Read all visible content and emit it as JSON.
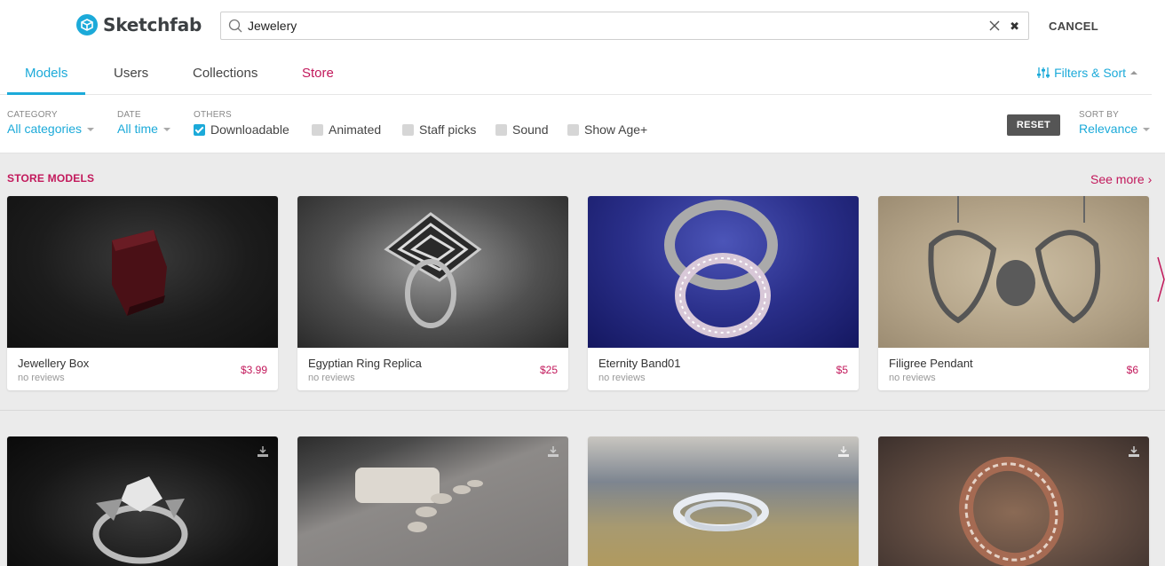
{
  "app": {
    "name": "Sketchfab"
  },
  "search": {
    "value": "Jewelery",
    "placeholder": "Search",
    "cancel_label": "CANCEL"
  },
  "tabs": [
    {
      "label": "Models",
      "active": true
    },
    {
      "label": "Users",
      "active": false
    },
    {
      "label": "Collections",
      "active": false
    },
    {
      "label": "Store",
      "active": false
    }
  ],
  "filters_sort_label": "Filters & Sort",
  "filters": {
    "category": {
      "label": "CATEGORY",
      "value": "All categories"
    },
    "date": {
      "label": "DATE",
      "value": "All time"
    },
    "others": {
      "label": "OTHERS",
      "options": [
        {
          "label": "Downloadable",
          "checked": true
        },
        {
          "label": "Animated",
          "checked": false
        },
        {
          "label": "Staff picks",
          "checked": false
        },
        {
          "label": "Sound",
          "checked": false
        },
        {
          "label": "Show Age+",
          "checked": false
        }
      ]
    },
    "reset_label": "RESET",
    "sort": {
      "label": "SORT BY",
      "value": "Relevance"
    }
  },
  "store_section": {
    "title": "STORE MODELS",
    "see_more": "See more ›",
    "models": [
      {
        "name": "Jewellery Box",
        "reviews": "no reviews",
        "price": "$3.99"
      },
      {
        "name": "Egyptian Ring Replica",
        "reviews": "no reviews",
        "price": "$25"
      },
      {
        "name": "Eternity Band01",
        "reviews": "no reviews",
        "price": "$5"
      },
      {
        "name": "Filigree Pendant",
        "reviews": "no reviews",
        "price": "$6"
      }
    ]
  },
  "downloadable_models": [
    {
      "icon": "download-icon"
    },
    {
      "icon": "download-icon"
    },
    {
      "icon": "download-icon"
    },
    {
      "icon": "download-icon"
    }
  ],
  "colors": {
    "accent": "#1caad9",
    "store": "#c2185b",
    "reset_bg": "#555555",
    "page_bg": "#ebebeb"
  }
}
